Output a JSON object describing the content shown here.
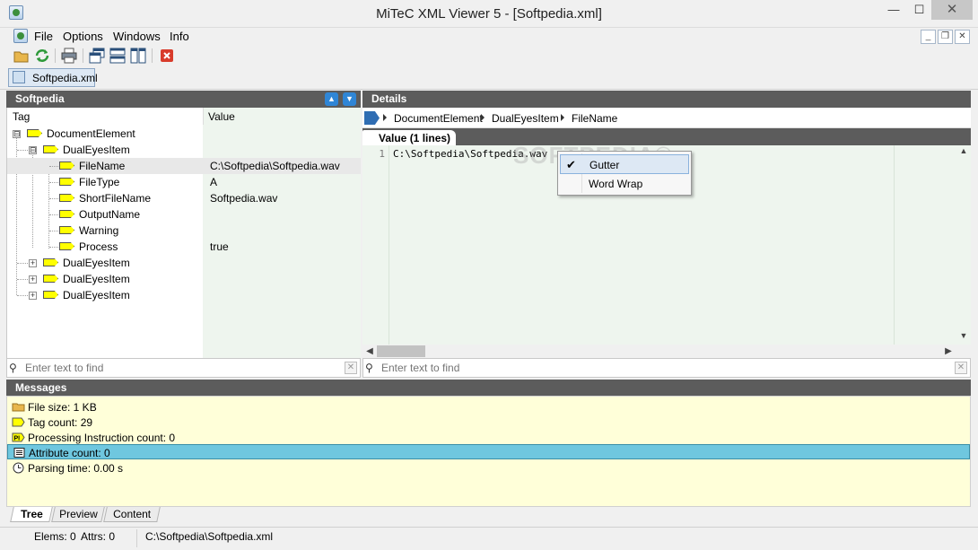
{
  "window": {
    "title": "MiTeC XML Viewer 5 - [Softpedia.xml]",
    "minimize_glyph": "—",
    "maximize_glyph": "☐",
    "close_glyph": "✕"
  },
  "menu": {
    "items": [
      "File",
      "Options",
      "Windows",
      "Info"
    ],
    "mdi_buttons": [
      "_",
      "❐",
      "✕"
    ]
  },
  "toolbar": {
    "icons": [
      "open-folder-icon",
      "refresh-icon",
      "print-icon",
      "window-cascade-icon",
      "tile-horizontal-icon",
      "tile-vertical-icon",
      "close-document-icon"
    ]
  },
  "document_tab": {
    "label": "Softpedia.xml"
  },
  "tree_panel": {
    "title": "Softpedia",
    "col_tag": "Tag",
    "col_value": "Value",
    "rows": [
      {
        "name": "DocumentElement",
        "value": "",
        "expander": "⊟"
      },
      {
        "name": "DualEyesItem",
        "value": "",
        "expander": "⊟"
      },
      {
        "name": "FileName",
        "value": "C:\\Softpedia\\Softpedia.wav",
        "expander": ""
      },
      {
        "name": "FileType",
        "value": "A",
        "expander": ""
      },
      {
        "name": "ShortFileName",
        "value": "Softpedia.wav",
        "expander": ""
      },
      {
        "name": "OutputName",
        "value": "",
        "expander": ""
      },
      {
        "name": "Warning",
        "value": "",
        "expander": ""
      },
      {
        "name": "Process",
        "value": "true",
        "expander": ""
      },
      {
        "name": "DualEyesItem",
        "value": "",
        "expander": "+"
      },
      {
        "name": "DualEyesItem",
        "value": "",
        "expander": "+"
      },
      {
        "name": "DualEyesItem",
        "value": "",
        "expander": "+"
      }
    ],
    "find_placeholder": "Enter text to find"
  },
  "details_panel": {
    "title": "Details",
    "breadcrumb": [
      "DocumentElement",
      "DualEyesItem",
      "FileName"
    ],
    "value_tab": "Value (1 lines)",
    "line_number": "1",
    "line_text": "C:\\Softpedia\\Softpedia.wav",
    "find_placeholder": "Enter text to find"
  },
  "context_menu": {
    "items": [
      {
        "label": "Gutter",
        "checked": "✔"
      },
      {
        "label": "Word Wrap",
        "checked": ""
      }
    ]
  },
  "watermark": "SOFTPEDIA®",
  "messages": {
    "title": "Messages",
    "items": [
      {
        "text": "File size: 1 KB",
        "icon": "folder-icon"
      },
      {
        "text": "Tag count: 29",
        "icon": "tag-icon"
      },
      {
        "text": "Processing Instruction count: 0",
        "icon": "pi-icon"
      },
      {
        "text": "Attribute count: 0",
        "icon": "attribute-icon"
      },
      {
        "text": "Parsing time: 0.00 s",
        "icon": "clock-icon"
      }
    ]
  },
  "bottom_tabs": [
    "Tree",
    "Preview",
    "Content"
  ],
  "status": {
    "elems": "Elems: 0",
    "attrs": "Attrs: 0",
    "path": "C:\\Softpedia\\Softpedia.xml"
  },
  "colors": {
    "header_bg": "#5c5c5c",
    "tag_icon": "#ffff00",
    "message_bg": "#ffffd9",
    "message_selected": "#6fc7df",
    "close_icon_red": "#d83b2b"
  }
}
